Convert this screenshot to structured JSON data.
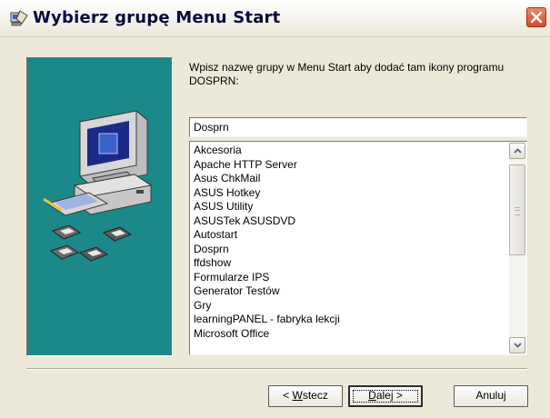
{
  "window": {
    "title": "Wybierz grupę Menu Start",
    "title_icon": "installer-icon",
    "close_icon": "close-icon"
  },
  "instruction": "Wpisz nazwę grupy w Menu Start aby dodać tam ikony programu  DOSPRN:",
  "group_input": {
    "value": "Dosprn"
  },
  "group_list": {
    "items": [
      "Akcesoria",
      "Apache HTTP Server",
      "Asus ChkMail",
      "ASUS Hotkey",
      "ASUS Utility",
      "ASUSTek ASUSDVD",
      "Autostart",
      "Dosprn",
      "ffdshow",
      "Formularze IPS",
      "Generator Testów",
      "Gry",
      "learningPANEL - fabryka lekcji",
      "Microsoft Office"
    ]
  },
  "buttons": {
    "back_prefix": "< ",
    "back_mnemonic": "W",
    "back_rest": "stecz",
    "next_mnemonic": "D",
    "next_rest": "alej >",
    "cancel_label": "Anuluj"
  },
  "colors": {
    "panel_teal": "#1b8889",
    "dialog_bg": "#ece9d8",
    "close_red": "#d44a2b"
  }
}
